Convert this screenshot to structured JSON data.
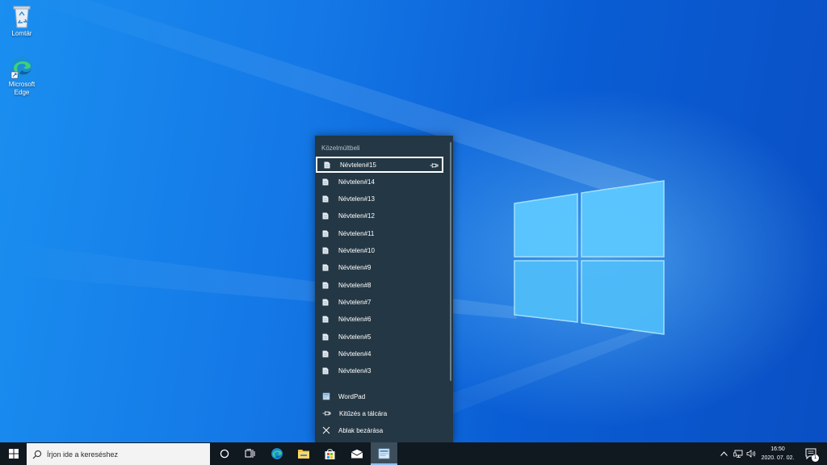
{
  "desktop": {
    "icons": [
      {
        "label": "Lomtár",
        "icon": "recycle-bin-icon"
      },
      {
        "label": "Microsoft Edge",
        "icon": "edge-icon"
      }
    ]
  },
  "jumplist": {
    "section_title": "Közelmúltbeli",
    "recent_items": [
      "Névtelen#15",
      "Névtelen#14",
      "Névtelen#13",
      "Névtelen#12",
      "Névtelen#11",
      "Névtelen#10",
      "Névtelen#9",
      "Névtelen#8",
      "Névtelen#7",
      "Névtelen#6",
      "Névtelen#5",
      "Névtelen#4",
      "Névtelen#3"
    ],
    "selected_index": 0,
    "tasks": {
      "app": "WordPad",
      "pin": "Kitűzés a tálcára",
      "close": "Ablak bezárása"
    }
  },
  "taskbar": {
    "search_placeholder": "Írjon ide a kereséshez",
    "apps": [
      "cortana-icon",
      "task-view-icon",
      "edge-icon",
      "file-explorer-icon",
      "store-icon",
      "mail-icon",
      "wordpad-icon"
    ],
    "active_app": "wordpad-icon",
    "clock": {
      "time": "16:50",
      "date": "2020. 07. 02."
    },
    "notification_count": "1"
  },
  "colors": {
    "jumplist_bg": "#243744",
    "taskbar_bg": "#101820",
    "accent": "#8cc1f2"
  }
}
